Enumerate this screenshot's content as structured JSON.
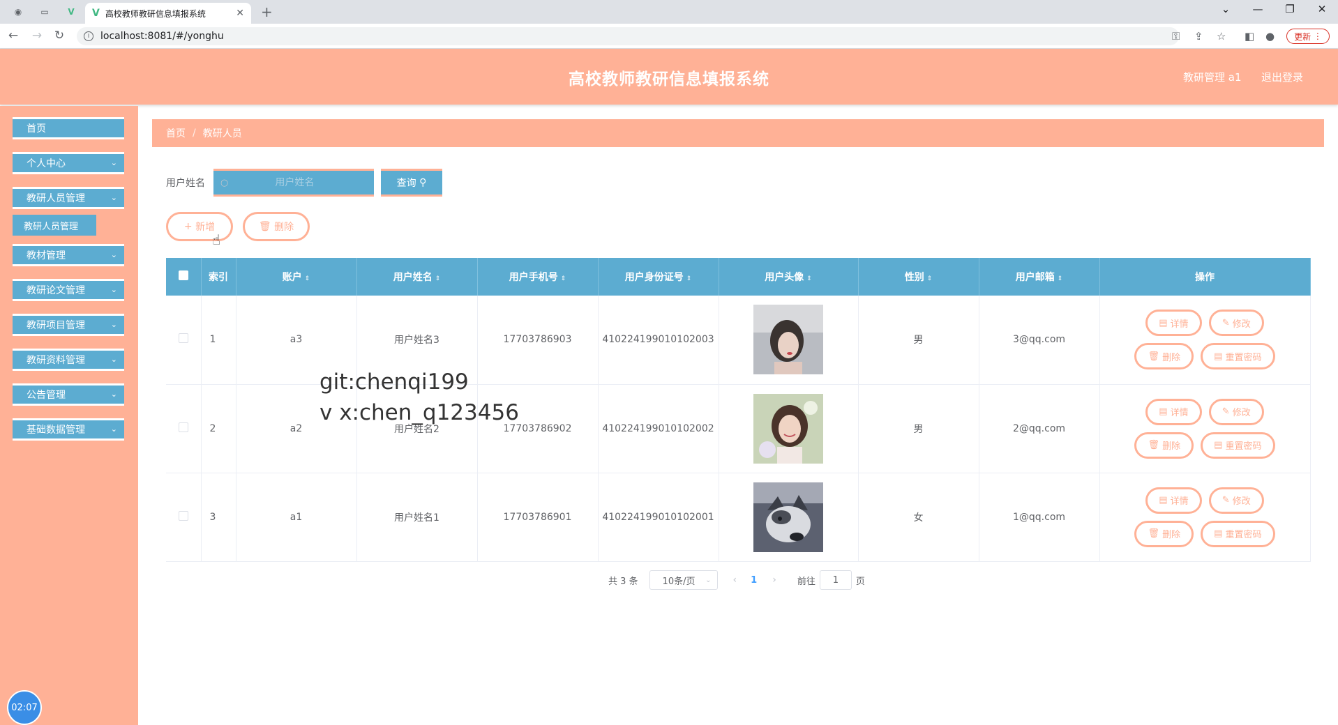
{
  "browser": {
    "tab_title": "高校教师教研信息填报系统",
    "url": "localhost:8081/#/yonghu",
    "update_label": "更新"
  },
  "header": {
    "title": "高校教师教研信息填报系统",
    "user": "教研管理 a1",
    "logout": "退出登录"
  },
  "sidebar": {
    "items": [
      {
        "label": "首页"
      },
      {
        "label": "个人中心"
      },
      {
        "label": "教研人员管理"
      },
      {
        "label": "教材管理"
      },
      {
        "label": "教研论文管理"
      },
      {
        "label": "教研项目管理"
      },
      {
        "label": "教研资料管理"
      },
      {
        "label": "公告管理"
      },
      {
        "label": "基础数据管理"
      }
    ],
    "sub_item": "教研人员管理",
    "clock": "02:07"
  },
  "breadcrumb": {
    "home": "首页",
    "current": "教研人员"
  },
  "search": {
    "label": "用户姓名",
    "placeholder": "用户姓名",
    "button": "查询"
  },
  "actions": {
    "add": "新增",
    "delete": "删除"
  },
  "table": {
    "columns": [
      "索引",
      "账户",
      "用户姓名",
      "用户手机号",
      "用户身份证号",
      "用户头像",
      "性别",
      "用户邮箱",
      "操作"
    ],
    "rows": [
      {
        "index": "1",
        "account": "a3",
        "name": "用户姓名3",
        "phone": "17703786903",
        "idcard": "410224199010102003",
        "gender": "男",
        "email": "3@qq.com"
      },
      {
        "index": "2",
        "account": "a2",
        "name": "用户姓名2",
        "phone": "17703786902",
        "idcard": "410224199010102002",
        "gender": "男",
        "email": "2@qq.com"
      },
      {
        "index": "3",
        "account": "a1",
        "name": "用户姓名1",
        "phone": "17703786901",
        "idcard": "410224199010102001",
        "gender": "女",
        "email": "1@qq.com"
      }
    ],
    "row_actions": {
      "detail": "详情",
      "edit": "修改",
      "delete": "删除",
      "reset": "重置密码"
    }
  },
  "pagination": {
    "total": "共 3 条",
    "page_size": "10条/页",
    "current": "1",
    "goto_prefix": "前往",
    "goto_value": "1",
    "goto_suffix": "页"
  },
  "watermark": {
    "line1": "git:chenqi199",
    "line2": "v x:chen_q123456"
  },
  "colors": {
    "accent": "#ffb196",
    "menu": "#5cacd1"
  }
}
